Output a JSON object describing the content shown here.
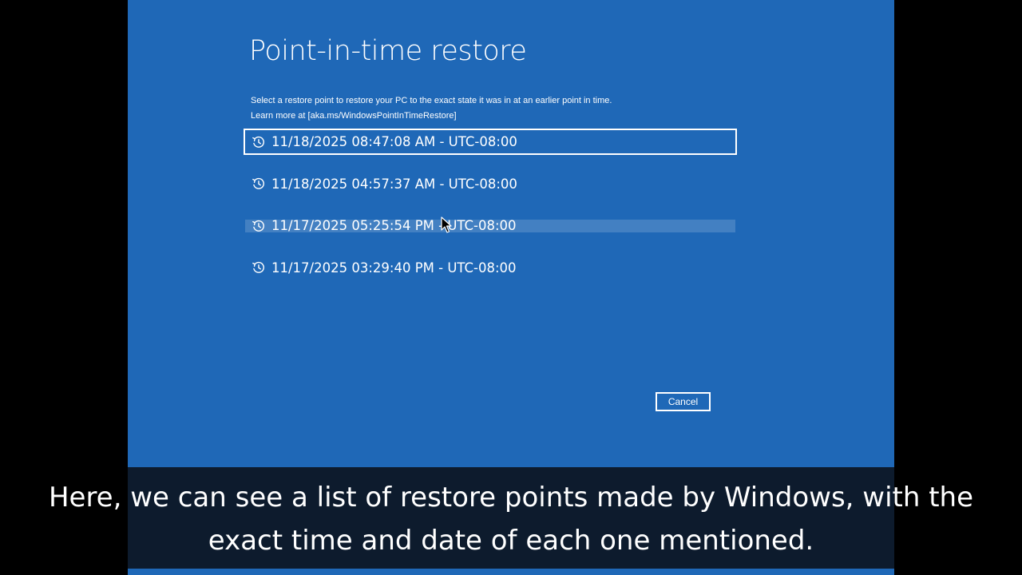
{
  "screen": {
    "title": "Point-in-time restore",
    "description": {
      "line1": "Select a restore point to restore your PC to the exact state it was in at an earlier point in time.",
      "line2": "Learn more at [aka.ms/WindowsPointInTimeRestore]"
    },
    "restore_points": [
      {
        "label": "11/18/2025 08:47:08 AM - UTC-08:00",
        "icon": "history-icon",
        "state": "selected"
      },
      {
        "label": "11/18/2025 04:57:37 AM - UTC-08:00",
        "icon": "history-icon",
        "state": "normal"
      },
      {
        "label": "11/17/2025 05:25:54 PM - UTC-08:00",
        "icon": "history-icon",
        "state": "hover"
      },
      {
        "label": "11/17/2025 03:29:40 PM - UTC-08:00",
        "icon": "history-icon",
        "state": "normal"
      }
    ],
    "cancel_label": "Cancel"
  },
  "caption": {
    "line1": "Here, we can see a list of restore points made by Windows, with the",
    "line2": "exact time and date of each one mentioned."
  },
  "colors": {
    "background": "#1f68b7",
    "text": "#ffffff",
    "caption_background": "#0d1b2d",
    "letterbox": "#000000"
  }
}
